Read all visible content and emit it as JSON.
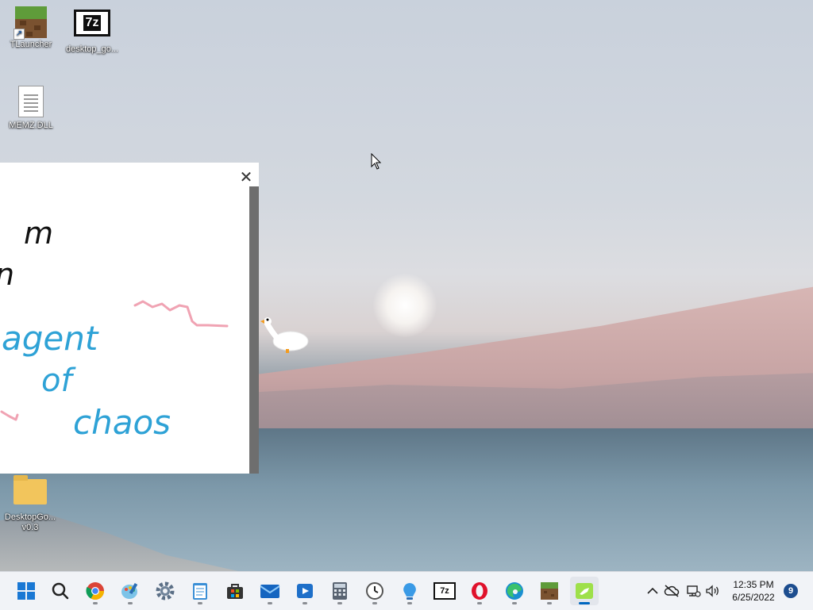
{
  "desktop": {
    "icons": [
      {
        "label": "TLauncher"
      },
      {
        "label": "desktop_go..."
      },
      {
        "label": "MEMZ.DLL"
      },
      {
        "label": "DesktopGo...\nv0.3"
      }
    ],
    "sz_text": "7z"
  },
  "notepad": {
    "close_symbol": "✕",
    "handwriting": [
      "m",
      "n",
      "agent",
      "of",
      "chaos"
    ]
  },
  "taskbar": {
    "apps": [
      {
        "name": "start-icon"
      },
      {
        "name": "search-icon"
      },
      {
        "name": "chrome-icon"
      },
      {
        "name": "paint-icon"
      },
      {
        "name": "settings-icon"
      },
      {
        "name": "notepad-icon"
      },
      {
        "name": "store-icon"
      },
      {
        "name": "mail-icon"
      },
      {
        "name": "media-player-icon"
      },
      {
        "name": "calculator-icon"
      },
      {
        "name": "clock-icon"
      },
      {
        "name": "tips-icon"
      },
      {
        "name": "7zip-icon",
        "text": "7z"
      },
      {
        "name": "opera-icon"
      },
      {
        "name": "edge-icon"
      },
      {
        "name": "minecraft-icon"
      },
      {
        "name": "desktop-goose-icon"
      }
    ],
    "tray": {
      "chevron": "^",
      "time": "12:35 PM",
      "date": "6/25/2022",
      "notification_count": "9"
    }
  }
}
